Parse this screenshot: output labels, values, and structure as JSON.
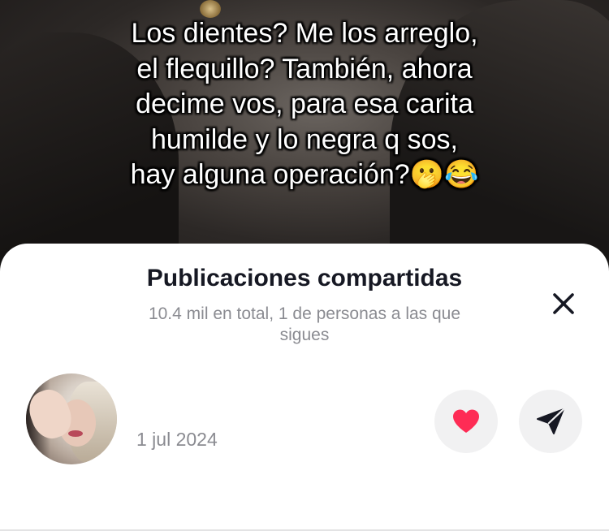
{
  "video": {
    "caption_lines": [
      "Los dientes? Me los arreglo,",
      "el flequillo? También, ahora",
      "decime vos, para esa carita",
      "humilde y lo negra q sos,",
      "hay alguna operación?🫢😂"
    ]
  },
  "sheet": {
    "title": "Publicaciones compartidas",
    "subtitle": "10.4 mil en total, 1 de personas a las que sigues",
    "close_icon": "close-icon"
  },
  "shares": [
    {
      "date": "1 jul 2024",
      "like_icon": "heart-icon",
      "send_icon": "send-icon"
    }
  ],
  "colors": {
    "heart": "#fe2c55",
    "title": "#161823",
    "secondary_text": "#8a8b91",
    "button_bg": "#f1f1f2"
  }
}
